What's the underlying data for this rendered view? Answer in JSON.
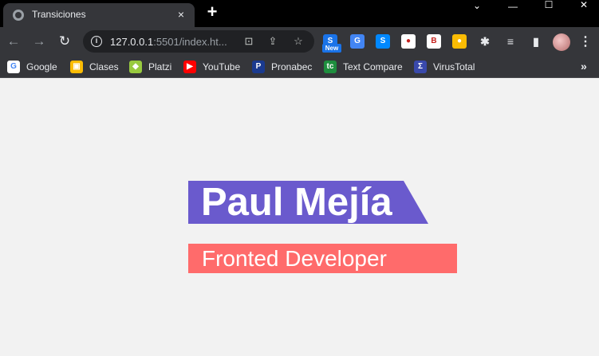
{
  "browser": {
    "tab": {
      "title": "Transiciones",
      "close_glyph": "×"
    },
    "new_tab_glyph": "+",
    "window_controls": {
      "chevron": "⌄",
      "minimize": "—",
      "maximize": "☐",
      "close": "✕"
    },
    "toolbar": {
      "back_glyph": "←",
      "forward_glyph": "→",
      "reload_glyph": "↻",
      "url_host": "127.0.0.1",
      "url_rest": ":5501/index.ht...",
      "star_glyph": "☆",
      "share_glyph": "⇪",
      "translate_glyph": "⊡",
      "info_glyph": "i",
      "new_badge": "New",
      "extensions": [
        {
          "name": "notepad-extension-icon",
          "glyph": "S",
          "color": "#1a73e8"
        },
        {
          "name": "translate-extension-icon",
          "glyph": "G",
          "color": "#4285f4"
        },
        {
          "name": "shazam-extension-icon",
          "glyph": "S",
          "color": "#0088ff"
        },
        {
          "name": "record-extension-icon",
          "glyph": "●",
          "color": "#ffffff"
        },
        {
          "name": "b-extension-icon",
          "glyph": "B",
          "color": "#ffffff"
        },
        {
          "name": "color-picker-extension-icon",
          "glyph": "●",
          "color": "#fbbc04"
        },
        {
          "name": "puzzle-icon",
          "glyph": "✱",
          "color": "#35363a"
        },
        {
          "name": "media-queue-icon",
          "glyph": "≡",
          "color": "#35363a"
        },
        {
          "name": "side-panel-icon",
          "glyph": "▮",
          "color": "#35363a"
        }
      ],
      "menu_glyph": "⋮"
    },
    "bookmarks": [
      {
        "label": "Google",
        "icon": "google-icon",
        "glyph": "G",
        "color": "#ffffff"
      },
      {
        "label": "Clases",
        "icon": "classroom-icon",
        "glyph": "▣",
        "color": "#fbbc04"
      },
      {
        "label": "Platzi",
        "icon": "platzi-icon",
        "glyph": "◆",
        "color": "#98ca3f"
      },
      {
        "label": "YouTube",
        "icon": "youtube-icon",
        "glyph": "▶",
        "color": "#ff0000"
      },
      {
        "label": "Pronabec",
        "icon": "pronabec-icon",
        "glyph": "P",
        "color": "#1a3a8f"
      },
      {
        "label": "Text Compare",
        "icon": "text-compare-icon",
        "glyph": "tc",
        "color": "#1e8e3e"
      },
      {
        "label": "VirusTotal",
        "icon": "virustotal-icon",
        "glyph": "Σ",
        "color": "#3949ab"
      }
    ],
    "bookmarks_more": "»"
  },
  "page": {
    "name": "Paul Mejía",
    "role": "Fronted Developer"
  },
  "colors": {
    "name_bg": "#6a5acd",
    "role_bg": "#ff6b6b",
    "page_bg": "#f2f2f2"
  }
}
